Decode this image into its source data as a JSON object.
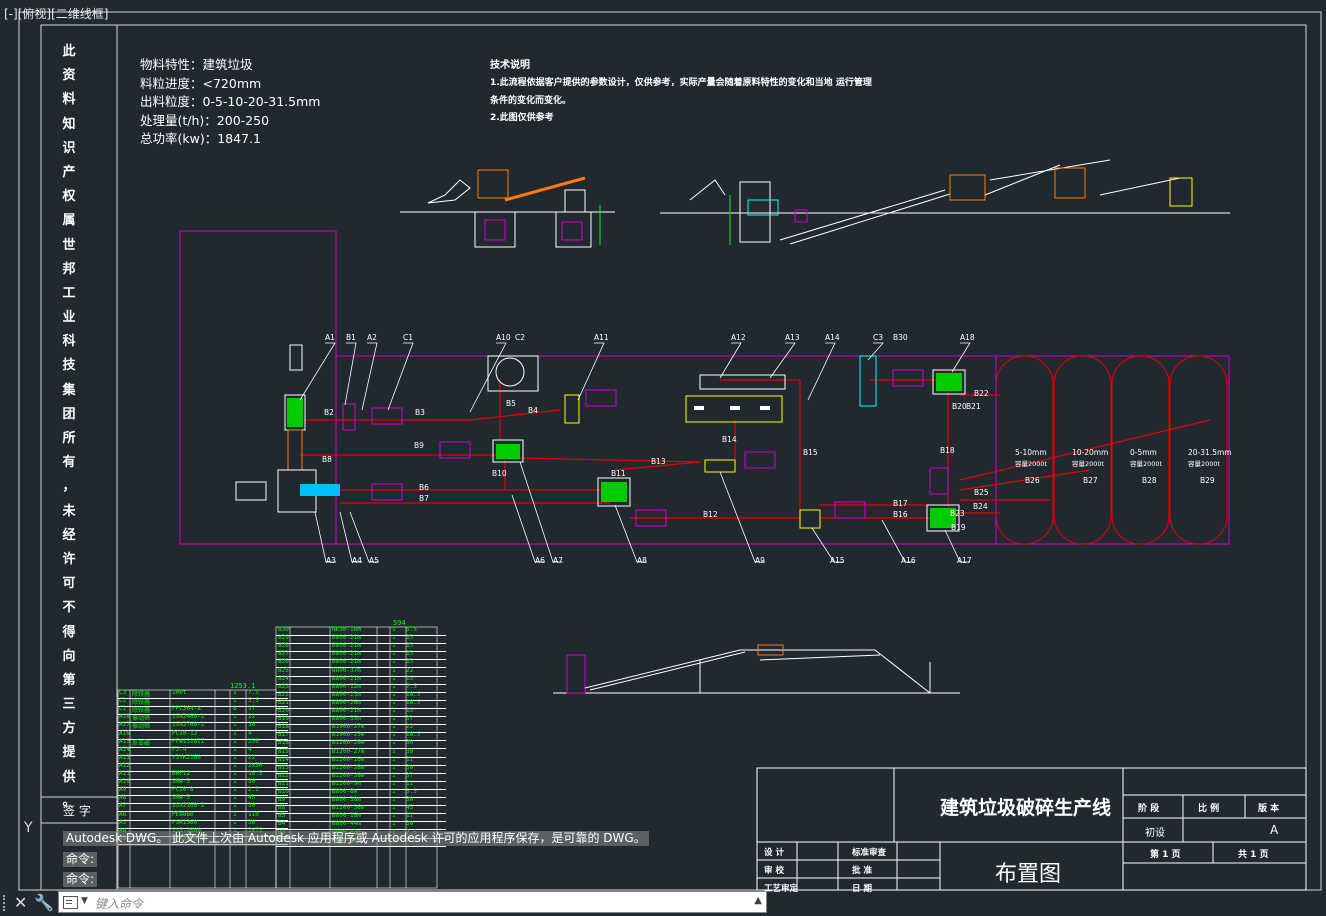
{
  "viewport": {
    "label": "[-][俯视][二维线框]"
  },
  "side_text": [
    "此",
    "资",
    "料",
    "知",
    "识",
    "产",
    "权",
    "属",
    "世",
    "邦",
    "工",
    "业",
    "科",
    "技",
    "集",
    "团",
    "所",
    "有",
    "，",
    "未",
    "经",
    "许",
    "可",
    "不",
    "得",
    "向",
    "第",
    "三",
    "方",
    "提",
    "供",
    "。"
  ],
  "sign_label": "签  字",
  "material_info": [
    "物料特性：建筑垃圾",
    "料粒进度：<720mm",
    "出料粒度：0-5-10-20-31.5mm",
    "处理量(t/h)：200-250",
    "总功率(kw)：1847.1"
  ],
  "tech_notes": {
    "title": "技术说明",
    "lines": [
      "1.此流程依据客户提供的参数设计，仅供参考，实际产量会随着原料特性的变化和当地  运行管理",
      "条件的变化而变化。",
      "2.此图仅供参考"
    ]
  },
  "labels_top": [
    "A1",
    "B1",
    "A2",
    "C1",
    "A10",
    "C2",
    "A11",
    "A12",
    "A13",
    "A14",
    "C3",
    "B30",
    "A18"
  ],
  "labels_bottom": [
    "A3",
    "A4",
    "A5",
    "A6",
    "A7",
    "A8",
    "A9",
    "A15",
    "A16",
    "A17"
  ],
  "labels_mid": [
    "B2",
    "B3",
    "B4",
    "B5",
    "B8",
    "B9",
    "B10",
    "B6",
    "B7",
    "B11",
    "B13",
    "B12",
    "B14",
    "B15",
    "B17",
    "B16",
    "B18",
    "B19",
    "B20",
    "B21",
    "B22",
    "B23",
    "B24",
    "B25",
    "B26",
    "B27",
    "B28",
    "B29"
  ],
  "silos": [
    {
      "size": "5-10mm",
      "cap": "容量2000t",
      "id": "B26"
    },
    {
      "size": "10-20mm",
      "cap": "容量2000t",
      "id": "B27"
    },
    {
      "size": "0-5mm",
      "cap": "容量2000t",
      "id": "B28"
    },
    {
      "size": "20-31.5mm",
      "cap": "容量2000t",
      "id": "B29"
    }
  ],
  "table_left_total": "1253.1",
  "table_right_total": "594",
  "table_left": [
    [
      "C3",
      "除铁器",
      "100t",
      "1",
      "7.5"
    ],
    [
      "C2",
      "除铁器",
      "",
      "1",
      "5.5"
    ],
    [
      "C1",
      "除铁器",
      "PPC364-8",
      "8",
      "37"
    ],
    [
      "A18",
      "振动筛",
      "S5X2460-2",
      "1",
      "22"
    ],
    [
      "A17",
      "振动筛",
      "S5X2760-2",
      "1",
      "30"
    ],
    [
      "A16",
      "",
      "PCI0-12",
      "1",
      "4"
    ],
    [
      "A15",
      "反击破",
      "PFW1318II",
      "1",
      "250"
    ],
    [
      "A14",
      "",
      "FJ-4",
      "1",
      "4"
    ],
    [
      "A13",
      "",
      "Y3YK2160",
      "1",
      "22"
    ],
    [
      "A12",
      "",
      "",
      "1",
      "2x30"
    ],
    [
      "A11",
      "",
      "BHF12",
      "1",
      "16.5"
    ],
    [
      "A10",
      "",
      "SMW-5",
      "1",
      "30"
    ],
    [
      "A9",
      "",
      "PCI0-8",
      "1",
      "2.2"
    ],
    [
      "A8",
      "",
      "SMW-5",
      "1",
      "45"
    ],
    [
      "A7",
      "",
      "SSX2160-2",
      "1",
      "30"
    ],
    [
      "A6",
      "",
      "PEW860",
      "1",
      "110"
    ],
    [
      "A5",
      "",
      "PSK1360",
      "1",
      "30"
    ],
    [
      "A4",
      "",
      "SSJ-2000",
      "1",
      "2x75"
    ],
    [
      "A3",
      "",
      "S5X3075-2T",
      "1",
      "2x30"
    ]
  ],
  "table_right": [
    [
      "B30",
      "",
      "NE30-16m",
      "1",
      "5.5"
    ],
    [
      "B29",
      "",
      "B800-21m",
      "1",
      "15"
    ],
    [
      "B28",
      "",
      "B800-21m",
      "1",
      "15"
    ],
    [
      "B27",
      "",
      "B800-21m",
      "1",
      "15"
    ],
    [
      "B26",
      "",
      "B800-21m",
      "1",
      "15"
    ],
    [
      "B25",
      "",
      "B800-37m",
      "1",
      "22"
    ],
    [
      "B24",
      "",
      "B800-21m",
      "1",
      "15"
    ],
    [
      "B23",
      "",
      "B800-12m",
      "1",
      "7.5"
    ],
    [
      "B22",
      "",
      "B800-25m",
      "1",
      "18.5"
    ],
    [
      "B21",
      "",
      "B800-26m",
      "1",
      "18.5"
    ],
    [
      "B20",
      "",
      "B800-21m",
      "1",
      "15"
    ],
    [
      "B19",
      "",
      "B800-55m",
      "1",
      "37"
    ],
    [
      "B18",
      "",
      "B1000-27m",
      "1",
      "22"
    ],
    [
      "B17",
      "",
      "B1000-23m",
      "1",
      "18.5"
    ],
    [
      "B16",
      "",
      "B1200-28m",
      "1",
      "30"
    ],
    [
      "B15",
      "",
      "B1200-27m",
      "1",
      "30"
    ],
    [
      "B14",
      "",
      "B1200-16m",
      "1",
      "11"
    ],
    [
      "B13",
      "",
      "B1200-28m",
      "1",
      "30"
    ],
    [
      "B12",
      "",
      "B1200-38m",
      "1",
      "37"
    ],
    [
      "B11",
      "",
      "B1200-9m",
      "1",
      "11"
    ],
    [
      "B10",
      "",
      "B800-8m",
      "1",
      "5.5"
    ],
    [
      "B9",
      "",
      "B800-38m",
      "1",
      "30"
    ],
    [
      "B8",
      "",
      "B1200-56m",
      "1",
      "45"
    ],
    [
      "B5",
      "",
      "B800-16m",
      "1",
      "11"
    ],
    [
      "B4",
      "",
      "B800-44m",
      "1",
      "30"
    ],
    [
      "B3",
      "",
      "B800-13m",
      "1",
      "7.5"
    ],
    [
      "B2",
      "",
      "B800-10m",
      "1",
      "7.5"
    ]
  ],
  "title_block": {
    "project": "建筑垃圾破碎生产线",
    "drawing": "布置图",
    "stage": "阶  段",
    "scale": "比  例",
    "version": "版  本",
    "stage_val": "初设",
    "version_val": "A",
    "page": "第 1 页",
    "total": "共 1 页",
    "rows": [
      "设  计",
      "审  校",
      "工艺审定"
    ],
    "rows2": [
      "标准审查",
      "批  准",
      "日  期"
    ]
  },
  "command": {
    "history": "Autodesk DWG。  此文件上次由 Autodesk 应用程序或 Autodesk 许可的应用程序保存，是可靠的 DWG。",
    "prompt1": "命令:",
    "prompt2": "命令:",
    "placeholder": "键入命令"
  },
  "colors": {
    "background": "#212830",
    "magenta": "#d100d1",
    "red": "#e60000",
    "green": "#00ff00",
    "yellow": "#ffff00",
    "white": "#ffffff",
    "cyan": "#00ffff"
  }
}
